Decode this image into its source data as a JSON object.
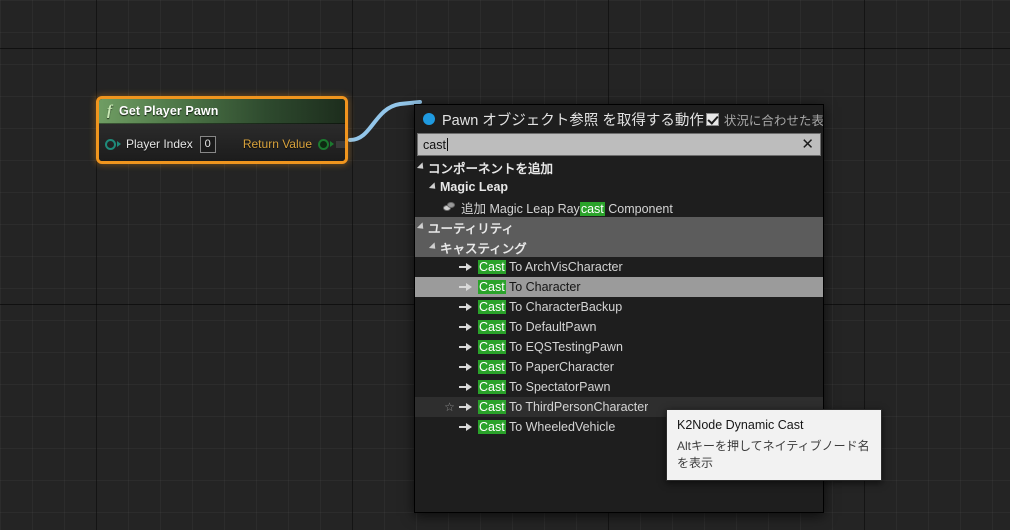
{
  "node": {
    "title": "Get Player Pawn",
    "fx_glyph": "f",
    "input_pin_label": "Player Index",
    "input_pin_value": "0",
    "output_pin_label": "Return Value",
    "border_color": "#f0951e",
    "title_color": "#6f9d63"
  },
  "panel": {
    "header": {
      "type_label": "Pawn オブジェクト参照 を取得する動作",
      "context_checkbox_label": "状況に合わせた表示",
      "context_checkbox_checked": true,
      "dot_color": "#1f9ae0"
    },
    "search": {
      "value": "cast",
      "placeholder": "",
      "clear_glyph": "✕"
    },
    "highlight_color": "#2aa22a",
    "tree": [
      {
        "label": "コンポーネントを追加",
        "kind": "category",
        "indent": 0,
        "state": "normal"
      },
      {
        "label": "Magic Leap",
        "kind": "category",
        "indent": 1,
        "state": "normal"
      },
      {
        "prefix": "追加 Magic Leap Ray",
        "match": "cast",
        "suffix": " Component",
        "kind": "component",
        "indent": 2,
        "state": "normal"
      },
      {
        "label": "ユーティリティ",
        "kind": "category",
        "indent": 0,
        "state": "block"
      },
      {
        "label": "キャスティング",
        "kind": "category",
        "indent": 1,
        "state": "block"
      },
      {
        "prefix": "",
        "match": "Cast",
        "suffix": " To ArchVisCharacter",
        "kind": "action",
        "indent": 2,
        "state": "normal"
      },
      {
        "prefix": "",
        "match": "Cast",
        "suffix": " To Character",
        "kind": "action",
        "indent": 2,
        "state": "selected"
      },
      {
        "prefix": "",
        "match": "Cast",
        "suffix": " To CharacterBackup",
        "kind": "action",
        "indent": 2,
        "state": "normal"
      },
      {
        "prefix": "",
        "match": "Cast",
        "suffix": " To DefaultPawn",
        "kind": "action",
        "indent": 2,
        "state": "normal"
      },
      {
        "prefix": "",
        "match": "Cast",
        "suffix": " To EQSTestingPawn",
        "kind": "action",
        "indent": 2,
        "state": "normal"
      },
      {
        "prefix": "",
        "match": "Cast",
        "suffix": " To PaperCharacter",
        "kind": "action",
        "indent": 2,
        "state": "normal"
      },
      {
        "prefix": "",
        "match": "Cast",
        "suffix": " To SpectatorPawn",
        "kind": "action",
        "indent": 2,
        "state": "normal"
      },
      {
        "prefix": "",
        "match": "Cast",
        "suffix": " To ThirdPersonCharacter",
        "kind": "action",
        "indent": 2,
        "state": "hover",
        "star": true
      },
      {
        "prefix": "",
        "match": "Cast",
        "suffix": " To WheeledVehicle",
        "kind": "action",
        "indent": 2,
        "state": "normal"
      }
    ]
  },
  "tooltip": {
    "title": "K2Node Dynamic Cast",
    "subtitle": "Altキーを押してネイティブノード名を表示"
  }
}
